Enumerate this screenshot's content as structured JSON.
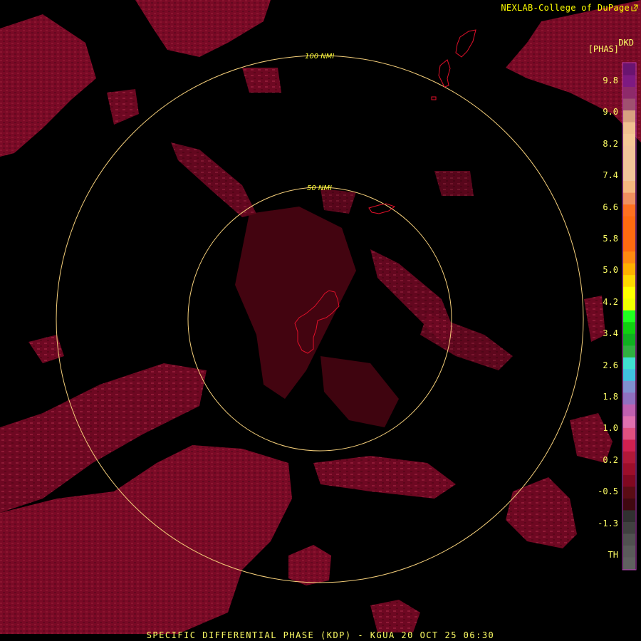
{
  "header": {
    "credit": "NEXLAB-College of DuPage",
    "product_code": "DKD",
    "product_unit": "[PHAS]"
  },
  "rings": [
    {
      "label": "100 NMI"
    },
    {
      "label": "50 NMI"
    }
  ],
  "legend": {
    "ticks": [
      "9.8",
      "9.0",
      "8.2",
      "7.4",
      "6.6",
      "5.8",
      "5.0",
      "4.2",
      "3.4",
      "2.6",
      "1.8",
      "1.0",
      "0.2",
      "-0.5",
      "-1.3",
      "TH"
    ],
    "colors": [
      "#6a1470",
      "#7e1a82",
      "#8e2a6a",
      "#a05070",
      "#d8a080",
      "#f0c090",
      "#f4c896",
      "#f2c49a",
      "#f2c49a",
      "#f2c49a",
      "#f5b880",
      "#f09060",
      "#ff7020",
      "#ff6a10",
      "#ff6a10",
      "#ff6a10",
      "#ff8a10",
      "#ffb000",
      "#ffd800",
      "#ffff00",
      "#f0ff00",
      "#20ff20",
      "#10d010",
      "#10b020",
      "#30b040",
      "#40e0d0",
      "#40c0e0",
      "#8090d0",
      "#9070c0",
      "#c060b0",
      "#e070b0",
      "#e05080",
      "#d02050",
      "#b01838",
      "#9c0e2a",
      "#800820",
      "#5a0c14",
      "#400810",
      "#303030",
      "#404040",
      "#505050",
      "#5a5a5a",
      "#606060"
    ]
  },
  "footer": {
    "title": "SPECIFIC DIFFERENTIAL PHASE (KDP) - KGUA 20 OCT 25 06:30"
  }
}
